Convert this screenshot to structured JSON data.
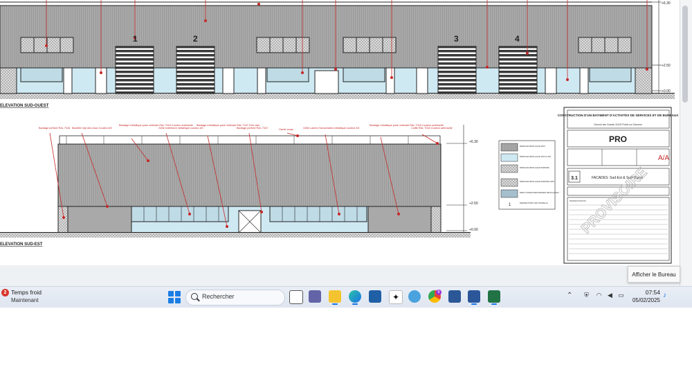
{
  "drawing": {
    "door_numbers": [
      "1",
      "2",
      "3",
      "4"
    ],
    "elevation_top_title": "ELEVATION SUD-OUEST",
    "elevation_bottom_title": "ELEVATION SUD-EST",
    "levels_top": [
      "+6.30",
      "+2.50",
      "+0.00"
    ],
    "levels_bottom": [
      "+6.30",
      "+2.50",
      "+0.00"
    ],
    "annotations": [
      "Bardage perforé RAL 7016",
      "Barrette rept des eaux Couleur AS",
      "Bardage métallique pose verticale RAL 7016 Couleur anthracite",
      "Grille extérieure métallique couleur AS",
      "Bardage métallique pose verticale RAL 7047 Gris clair",
      "Bardage perforé RAL 7047",
      "Garde corps",
      "Grille Lames Horizontales métallique couleur AS",
      "Bardage métallique pose verticale RAL 7016 Couleur anthracite",
      "Coiffe RAL 7016 Couleur anthracite"
    ],
    "legend_items": [
      "BARDAGE METALLIQUE GRIS",
      "BARDAGE METALLIQUE GRIS CLAIR",
      "BARDAGE METALLIQUE PERFORE",
      "BARDAGE METALLIQUE PERFORE GRIS",
      "BAIES VITREES MENUISERIES METALLIQUES",
      "REPERE PORTE SECTIONNELLE"
    ],
    "legend_number": "1",
    "cartouche": {
      "title": "CONSTRUCTION D'UN BATIMENT D'ACTIVITES DE SERVICES ET DE BUREAUX",
      "address": "Chemin des Grands 31120 Portet sur Garonne",
      "phase": "PRO",
      "sheet_number": "3.1",
      "sheet_title": "FACADES: Sud-Est & Sud-Ouest",
      "watermark": "PROVISOIRE",
      "logo": "A/A",
      "modifications_label": "MODIFICATIONS"
    }
  },
  "tooltip": "Afficher le Bureau",
  "taskbar": {
    "weather_badge": "2",
    "weather_title": "Temps froid",
    "weather_sub": "Maintenant",
    "search_placeholder": "Rechercher",
    "time": "07:54",
    "date": "05/02/2025",
    "pinned_badge": "6",
    "colors": {
      "accent": "#1a73e8",
      "weather": "#d8362c"
    }
  }
}
